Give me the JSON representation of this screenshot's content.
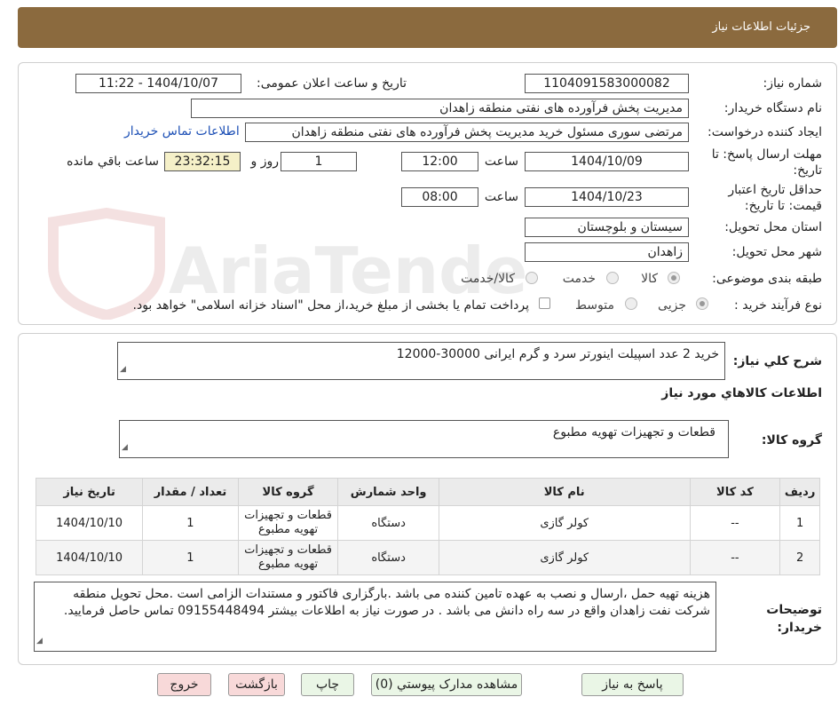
{
  "header": {
    "title": "جزئیات اطلاعات نیاز"
  },
  "watermark": {
    "text": "AriaTender.neT"
  },
  "details": {
    "need_number_label": "شماره نیاز:",
    "need_number": "1104091583000082",
    "announce_label": "تاریخ و ساعت اعلان عمومی:",
    "announce_value": "1404/10/07 - 11:22",
    "buyer_org_label": "نام دستگاه خریدار:",
    "buyer_org": "مدیریت پخش فرآورده های نفتی منطقه زاهدان",
    "creator_label": "ایجاد کننده درخواست:",
    "creator": "مرتضی سوری مسئول خرید  مدیریت پخش فرآورده های نفتی منطقه زاهدان",
    "contact_link": "اطلاعات تماس خریدار",
    "deadline_label": "مهلت ارسال پاسخ: تا تاریخ:",
    "deadline_date": "1404/10/09",
    "time_label": "ساعت",
    "deadline_time": "12:00",
    "days_value": "1",
    "days_label": "روز و",
    "remaining_time": "23:32:15",
    "remaining_label": "ساعت باقي مانده",
    "validity_label": "حداقل تاریخ اعتبار قیمت: تا تاریخ:",
    "validity_date": "1404/10/23",
    "validity_time": "08:00",
    "province_label": "استان محل تحویل:",
    "province": "سیستان و بلوچستان",
    "city_label": "شهر محل تحویل:",
    "city": "زاهدان",
    "category_label": "طبقه بندی موضوعی:",
    "category_options": [
      "کالا",
      "خدمت",
      "کالا/خدمت"
    ],
    "purchase_type_label": "نوع فرآیند خرید :",
    "purchase_options": [
      "جزیی",
      "متوسط"
    ],
    "payment_note": "پرداخت تمام یا بخشی از مبلغ خرید،از محل \"اسناد خزانه اسلامی\" خواهد بود."
  },
  "summary": {
    "label": "شرح کلي نیاز:",
    "text": "خرید 2 عدد اسپیلت  اینورتر سرد و گرم ایرانی 30000-12000",
    "goods_info_title": "اطلاعات کالاهاي مورد نیاز",
    "group_label": "گروه کالا:",
    "group_value": "قطعات و تجهیزات تهویه مطبوع"
  },
  "table": {
    "headers": [
      "ردیف",
      "کد کالا",
      "نام کالا",
      "واحد شمارش",
      "گروه کالا",
      "تعداد / مقدار",
      "تاریخ نیاز"
    ],
    "rows": [
      [
        "1",
        "--",
        "کولر گازی",
        "دستگاه",
        "قطعات و تجهیزات تهویه مطبوع",
        "1",
        "1404/10/10"
      ],
      [
        "2",
        "--",
        "کولر گازی",
        "دستگاه",
        "قطعات و تجهیزات تهویه مطبوع",
        "1",
        "1404/10/10"
      ]
    ]
  },
  "notes": {
    "label": "توضیحات خریدار:",
    "text": "هزینه تهیه حمل ،ارسال و نصب به عهده تامین کننده می باشد .بارگزاری فاکتور و مستندات الزامی است .محل تحویل منطقه شرکت نفت زاهدان واقع در سه راه دانش می باشد . در صورت نیاز به اطلاعات بیشتر 09155448494 تماس حاصل فرمایید."
  },
  "buttons": {
    "reply": "پاسخ به نیاز",
    "attachments": "مشاهده مدارک پیوستي (0)",
    "print": "چاپ",
    "back": "بازگشت",
    "exit": "خروج"
  }
}
